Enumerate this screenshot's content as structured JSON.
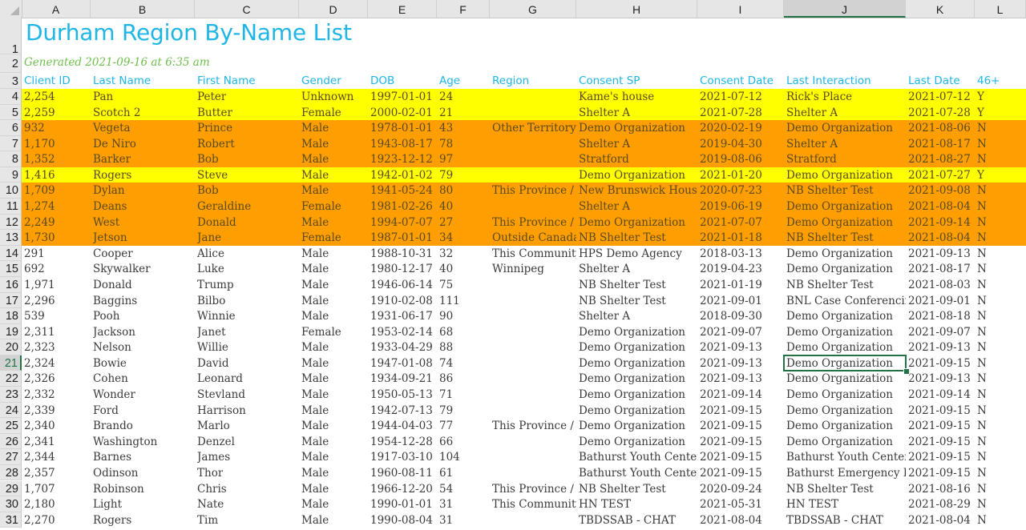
{
  "spreadsheet": {
    "columns": [
      "A",
      "B",
      "C",
      "D",
      "E",
      "F",
      "G",
      "H",
      "I",
      "J",
      "K",
      "L"
    ],
    "selected_column": "J",
    "selected_row": 21,
    "selected_cell": "J21",
    "title": "Durham Region By-Name List",
    "generated": "Generated 2021-09-16 at  6:35 am",
    "headers": [
      "Client ID",
      "Last Name",
      "First Name",
      "Gender",
      "DOB",
      "Age",
      "Region",
      "Consent SP",
      "Consent Date",
      "Last Interaction",
      "Last Date",
      "46+"
    ],
    "colors": {
      "title": "#1fb6e6",
      "generated": "#6cbf4a",
      "header": "#1fb6e6",
      "yellow_fill": "#ffff00",
      "orange_fill": "#ff9e00",
      "selection": "#217346"
    },
    "rows": [
      {
        "n": 4,
        "fill": "yellow",
        "cells": [
          "2,254",
          "Pan",
          "Peter",
          "Unknown",
          "1997-01-01",
          "24",
          "",
          "Kame's house",
          "2021-07-12",
          "Rick's Place",
          "2021-07-12",
          "Y"
        ]
      },
      {
        "n": 5,
        "fill": "yellow",
        "cells": [
          "2,259",
          "Scotch 2",
          "Butter",
          "Female",
          "2000-02-01",
          "21",
          "",
          "Shelter A",
          "2021-07-28",
          "Shelter A",
          "2021-07-28",
          "Y"
        ]
      },
      {
        "n": 6,
        "fill": "orange",
        "cells": [
          "932",
          "Vegeta",
          "Prince",
          "Male",
          "1978-01-01",
          "43",
          "Other Territory",
          "Demo Organization",
          "2020-02-19",
          "Demo Organization",
          "2021-08-06",
          "N"
        ]
      },
      {
        "n": 7,
        "fill": "orange",
        "cells": [
          "1,170",
          "De Niro",
          "Robert",
          "Male",
          "1943-08-17",
          "78",
          "",
          "Shelter A",
          "2019-04-30",
          "Shelter A",
          "2021-08-17",
          "N"
        ]
      },
      {
        "n": 8,
        "fill": "orange",
        "cells": [
          "1,352",
          "Barker",
          "Bob",
          "Male",
          "1923-12-12",
          "97",
          "",
          "Stratford",
          "2019-08-06",
          "Stratford",
          "2021-08-27",
          "N"
        ]
      },
      {
        "n": 9,
        "fill": "yellow",
        "cells": [
          "1,416",
          "Rogers",
          "Steve",
          "Male",
          "1942-01-02",
          "79",
          "",
          "Demo Organization",
          "2021-01-20",
          "Demo Organization",
          "2021-07-27",
          "Y"
        ]
      },
      {
        "n": 10,
        "fill": "orange",
        "cells": [
          "1,709",
          "Dylan",
          "Bob",
          "Male",
          "1941-05-24",
          "80",
          "This Province / Territory",
          "New Brunswick Housing",
          "2020-07-23",
          "NB Shelter Test",
          "2021-09-08",
          "N"
        ]
      },
      {
        "n": 11,
        "fill": "orange",
        "cells": [
          "1,274",
          "Deans",
          "Geraldine",
          "Female",
          "1981-02-26",
          "40",
          "",
          "Shelter A",
          "2019-06-19",
          "Demo Organization",
          "2021-08-04",
          "N"
        ]
      },
      {
        "n": 12,
        "fill": "orange",
        "cells": [
          "2,249",
          "West",
          "Donald",
          "Male",
          "1994-07-07",
          "27",
          "This Province / Territory",
          "Demo Organization",
          "2021-07-07",
          "Demo Organization",
          "2021-09-14",
          "N"
        ]
      },
      {
        "n": 13,
        "fill": "orange",
        "cells": [
          "1,730",
          "Jetson",
          "Jane",
          "Female",
          "1987-01-01",
          "34",
          "Outside Canada",
          "NB Shelter Test",
          "2021-01-18",
          "NB Shelter Test",
          "2021-08-04",
          "N"
        ]
      },
      {
        "n": 14,
        "fill": "",
        "cells": [
          "291",
          "Cooper",
          "Alice",
          "Male",
          "1988-10-31",
          "32",
          "This Community",
          "HPS Demo Agency",
          "2018-03-13",
          "Demo Organization",
          "2021-09-13",
          "N"
        ]
      },
      {
        "n": 15,
        "fill": "",
        "cells": [
          "692",
          "Skywalker",
          "Luke",
          "Male",
          "1980-12-17",
          "40",
          "Winnipeg",
          "Shelter A",
          "2019-04-23",
          "Demo Organization",
          "2021-08-17",
          "N"
        ]
      },
      {
        "n": 16,
        "fill": "",
        "cells": [
          "1,971",
          "Donald",
          "Trump",
          "Male",
          "1946-06-14",
          "75",
          "",
          "NB Shelter Test",
          "2021-01-19",
          "NB Shelter Test",
          "2021-08-03",
          "N"
        ]
      },
      {
        "n": 17,
        "fill": "",
        "cells": [
          "2,296",
          "Baggins",
          "Bilbo",
          "Male",
          "1910-02-08",
          "111",
          "",
          "NB Shelter Test",
          "2021-09-01",
          "BNL Case Conferencing",
          "2021-09-01",
          "N"
        ]
      },
      {
        "n": 18,
        "fill": "",
        "cells": [
          "539",
          "Pooh",
          "Winnie",
          "Male",
          "1931-06-17",
          "90",
          "",
          "Shelter A",
          "2018-09-30",
          "Demo Organization",
          "2021-08-18",
          "N"
        ]
      },
      {
        "n": 19,
        "fill": "",
        "cells": [
          "2,311",
          "Jackson",
          "Janet",
          "Female",
          "1953-02-14",
          "68",
          "",
          "Demo Organization",
          "2021-09-07",
          "Demo Organization",
          "2021-09-07",
          "N"
        ]
      },
      {
        "n": 20,
        "fill": "",
        "cells": [
          "2,323",
          "Nelson",
          "Willie",
          "Male",
          "1933-04-29",
          "88",
          "",
          "Demo Organization",
          "2021-09-13",
          "Demo Organization",
          "2021-09-13",
          "N"
        ]
      },
      {
        "n": 21,
        "fill": "",
        "cells": [
          "2,324",
          "Bowie",
          "David",
          "Male",
          "1947-01-08",
          "74",
          "",
          "Demo Organization",
          "2021-09-13",
          "Demo Organization",
          "2021-09-15",
          "N"
        ]
      },
      {
        "n": 22,
        "fill": "",
        "cells": [
          "2,326",
          "Cohen",
          "Leonard",
          "Male",
          "1934-09-21",
          "86",
          "",
          "Demo Organization",
          "2021-09-13",
          "Demo Organization",
          "2021-09-13",
          "N"
        ]
      },
      {
        "n": 23,
        "fill": "",
        "cells": [
          "2,332",
          "Wonder",
          "Stevland",
          "Male",
          "1950-05-13",
          "71",
          "",
          "Demo Organization",
          "2021-09-14",
          "Demo Organization",
          "2021-09-14",
          "N"
        ]
      },
      {
        "n": 24,
        "fill": "",
        "cells": [
          "2,339",
          "Ford",
          "Harrison",
          "Male",
          "1942-07-13",
          "79",
          "",
          "Demo Organization",
          "2021-09-15",
          "Demo Organization",
          "2021-09-15",
          "N"
        ]
      },
      {
        "n": 25,
        "fill": "",
        "cells": [
          "2,340",
          "Brando",
          "Marlo",
          "Male",
          "1944-04-03",
          "77",
          "This Province / Territory",
          "Demo Organization",
          "2021-09-15",
          "Demo Organization",
          "2021-09-15",
          "N"
        ]
      },
      {
        "n": 26,
        "fill": "",
        "cells": [
          "2,341",
          "Washington",
          "Denzel",
          "Male",
          "1954-12-28",
          "66",
          "",
          "Demo Organization",
          "2021-09-15",
          "Demo Organization",
          "2021-09-15",
          "N"
        ]
      },
      {
        "n": 27,
        "fill": "",
        "cells": [
          "2,344",
          "Barnes",
          "James",
          "Male",
          "1917-03-10",
          "104",
          "",
          "Bathurst Youth Center",
          "2021-09-15",
          "Bathurst Youth Center",
          "2021-09-15",
          "N"
        ]
      },
      {
        "n": 28,
        "fill": "",
        "cells": [
          "2,357",
          "Odinson",
          "Thor",
          "Male",
          "1960-08-11",
          "61",
          "",
          "Bathurst Youth Center",
          "2021-09-15",
          "Bathurst Emergency Housing",
          "2021-09-15",
          "N"
        ]
      },
      {
        "n": 29,
        "fill": "",
        "cells": [
          "1,707",
          "Robinson",
          "Chris",
          "Male",
          "1966-12-20",
          "54",
          "This Province / Territory",
          "NB Shelter Test",
          "2020-09-24",
          "NB Shelter Test",
          "2021-08-16",
          "N"
        ]
      },
      {
        "n": 30,
        "fill": "",
        "cells": [
          "2,180",
          "Light",
          "Nate",
          "Male",
          "1990-01-01",
          "31",
          "This Community",
          "HN TEST",
          "2021-05-31",
          "HN TEST",
          "2021-08-29",
          "N"
        ]
      },
      {
        "n": 31,
        "fill": "",
        "cells": [
          "2,270",
          "Rogers",
          "Tim",
          "Male",
          "1990-08-04",
          "31",
          "",
          "TBDSSAB - CHAT",
          "2021-08-04",
          "TBDSSAB - CHAT",
          "2021-08-04",
          "N"
        ]
      }
    ]
  }
}
